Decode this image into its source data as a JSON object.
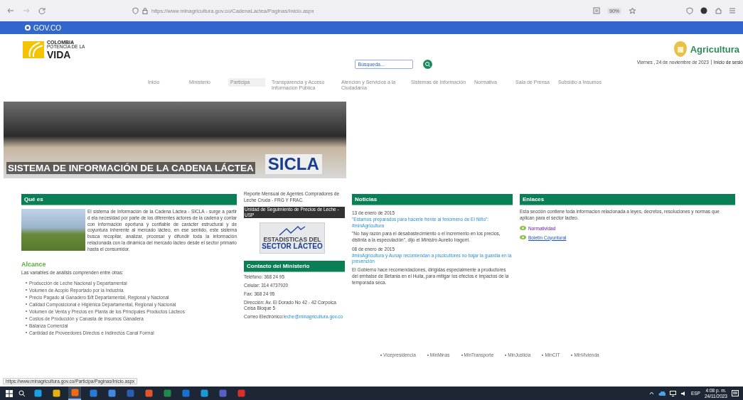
{
  "browser": {
    "url": "https://www.minagricultura.gov.co/CadenaLactea/Paginas/Inicio.aspx",
    "zoom": "90%"
  },
  "gov_bar": {
    "label": "GOV.CO"
  },
  "header": {
    "logo_lines": [
      "COLOMBIA",
      "POTENCIA DE LA",
      "VIDA"
    ],
    "search": {
      "placeholder": "Búsqueda..."
    },
    "brand": "Agricultura",
    "date": "Viernes , 24 de noviembre de 2023",
    "login": "Inicio de sesió"
  },
  "nav": [
    {
      "label": "Inicio",
      "selected": false
    },
    {
      "label": "Ministerio",
      "selected": false
    },
    {
      "label": "Participa",
      "selected": true
    },
    {
      "label": "Transparencia y Acceso Información Pública",
      "selected": false
    },
    {
      "label": "Atención y Servicios a la Ciudadanía",
      "selected": false
    },
    {
      "label": "Sistemas de Información",
      "selected": false
    },
    {
      "label": "Normativa",
      "selected": false
    },
    {
      "label": "Sala de Prensa",
      "selected": false
    },
    {
      "label": "Subsidio a Insumos",
      "selected": false
    }
  ],
  "banner": {
    "title": "SISTEMA DE INFORMACIÓN DE LA CADENA LÁCTEA",
    "acronym": "SICLA"
  },
  "que_es": {
    "heading": "Qué es",
    "text": "El sistema de Información de la Cadena Láctea - SICLA - surge a partir d ela necesidad por parte de los diferentes actores de la cadena y contar con información oportuna y confiable de carácter estructural y de coyuntura inherente al mercado lácteo, en ese sentido, este sistema busca recopilar, analizar, procesar y difundir toda la información relacionada con la dinámica del mercado lácteo desde el sector primario hasta el consumidor."
  },
  "alcance": {
    "heading": "Alcance",
    "intro": "Las variables de análisis comprenden entre otras:",
    "items": [
      "Producción de Leche Nacional y Departamental",
      "Volumen de Acopio Reportado por la Industria",
      "Precio Pagado al Ganadero $/lt Departamental, Regional y Nacional",
      "Calidad Composicional e Higiénica Departamental, Regional y Nacional",
      "Volumen de Venta y Precios en Planta de los Principales Productos Lácteos",
      "Costos de Producción y Canasta de Insumos Ganadera",
      "Balanza Comercial",
      "Cantidad de Proveedores Directos e Indirectos Canal Formal"
    ]
  },
  "reportes": {
    "text": "Reporte Mensual de Agentes Compradores de Leche Cruda - FRG Y FRAC.",
    "link": "Unidad de Seguimiento de Precios de Leche - USP",
    "stats_lines": [
      "ESTADISTICAS DEL",
      "SECTOR LÁCTEO"
    ]
  },
  "contacto": {
    "heading": "Contacto del Ministerio",
    "lines": [
      "Teléfono: 368 24 95",
      "Celular: 314 4737920",
      "Fax: 368 24 95",
      "Dirección: Av. El Dorado No 42 - 42 Corpoica Ceisa Bloque 5"
    ],
    "email_label": "Correo Electrónico:",
    "email": "leche@minagricultura.gov.co"
  },
  "noticias": {
    "heading": "Noticias",
    "items": [
      {
        "date": "13 de enero de 2015",
        "title": "\"Estamos preparados para hacerle frente al fenómeno de El Niño\": #minAgricultura",
        "summary": "\"No hay razón para el desabastecimiento o el incremento en los precios, distinta a la especulación\", dijo el *Ministro* Aurelio Iragorri."
      },
      {
        "date": "08 de enero de 2015",
        "title": "#minAgricultura y Aunap recomiendan a piscicultores no bajar la guardia en la prevención",
        "summary": "El Gobierno hace recomendaciones, dirigidas especialmente a productores del embalse de Betania en el Huila, para mitigar los efectos e impactos de la temporada seca."
      }
    ]
  },
  "enlaces": {
    "heading": "Enlaces",
    "text": "Esta sección contiene toda informacion relacionada a leyes, decretos, resoluciones y normas que aplican para el sector lacteo.",
    "links": [
      {
        "label": "Normatividad",
        "visited": true
      },
      {
        "label": "Boletín Coyuntural",
        "visited": false
      }
    ]
  },
  "footer_links": [
    "Vicepresidencia",
    "MinMinas",
    "MinTransporte",
    "MinJusticia",
    "MinCIT",
    "MinVivienda"
  ],
  "status_url": "https://www.minagricultura.gov.co/Participa/Paginas/Inicio.aspx",
  "taskbar": {
    "language": "ESP",
    "time": "4:08 p. m.",
    "date": "24/11/2023"
  }
}
